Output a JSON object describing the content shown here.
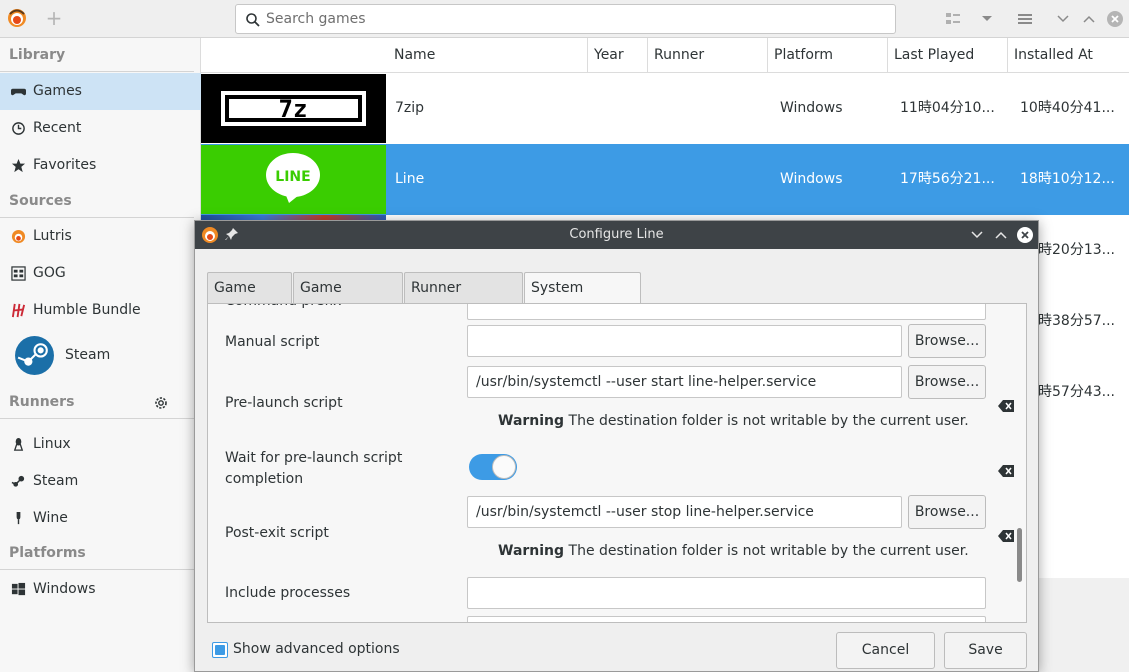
{
  "header": {
    "search_placeholder": "Search games"
  },
  "sidebar": {
    "sections": {
      "library": "Library",
      "sources": "Sources",
      "runners": "Runners",
      "platforms": "Platforms"
    },
    "library_items": [
      "Games",
      "Recent",
      "Favorites"
    ],
    "source_items": [
      "Lutris",
      "GOG",
      "Humble Bundle",
      "Steam"
    ],
    "runner_items": [
      "Linux",
      "Steam",
      "Wine"
    ],
    "platform_items": [
      "Windows"
    ]
  },
  "list": {
    "columns": [
      "Name",
      "Year",
      "Runner",
      "Platform",
      "Last Played",
      "Installed At"
    ],
    "rows": [
      {
        "name": "7zip",
        "year": "",
        "runner": "",
        "platform": "Windows",
        "last_played": "11時04分10...",
        "installed_at": "10時40分41..."
      },
      {
        "name": "Line",
        "year": "",
        "runner": "",
        "platform": "Windows",
        "last_played": "17時56分21...",
        "installed_at": "18時10分12..."
      }
    ],
    "partial_values": [
      "時20分13...",
      "時38分57...",
      "時57分43..."
    ],
    "thumbs": {
      "sevenzip": "7z",
      "line": "LINE"
    }
  },
  "dialog": {
    "title": "Configure Line",
    "tabs": [
      "Game info",
      "Game options",
      "Runner options",
      "System options"
    ],
    "active_tab": "System options",
    "fields": {
      "command_prefix_label": "Command prefix",
      "manual_script_label": "Manual script",
      "manual_script_value": "",
      "pre_launch_label": "Pre-launch script",
      "pre_launch_value": "/usr/bin/systemctl --user start line-helper.service",
      "wait_label": "Wait for pre-launch script completion",
      "post_exit_label": "Post-exit script",
      "post_exit_value": "/usr/bin/systemctl --user stop line-helper.service",
      "include_processes_label": "Include processes"
    },
    "browse_label": "Browse...",
    "warning_strong": "Warning",
    "warning_text": "The destination folder is not writable by the current user.",
    "show_advanced_label": "Show advanced options",
    "cancel_label": "Cancel",
    "save_label": "Save",
    "colors": {
      "accent": "#3d9be5",
      "titlebar": "#3e4347",
      "line_green": "#3acd01"
    }
  }
}
